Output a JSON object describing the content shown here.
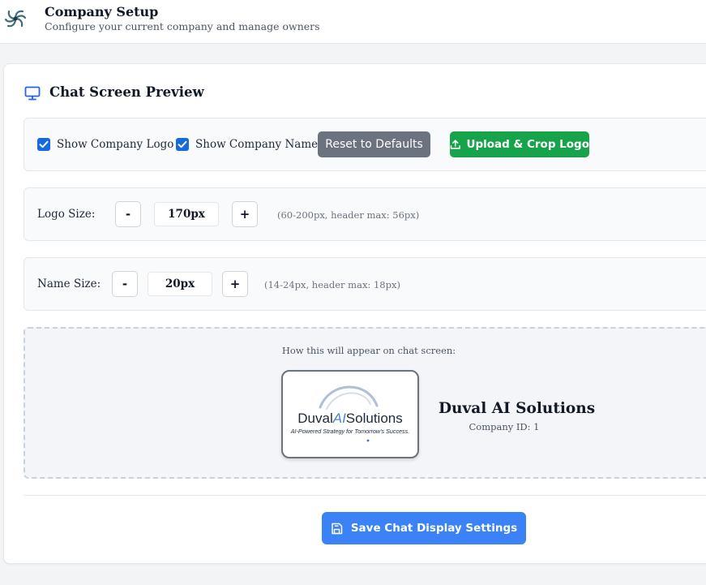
{
  "header": {
    "title": "Company Setup",
    "subtitle": "Configure your current company and manage owners",
    "logo_icon": "spiral-logo-icon"
  },
  "section": {
    "icon": "monitor-icon",
    "title": "Chat Screen Preview"
  },
  "toggles": {
    "show_logo": {
      "label": "Show Company Logo",
      "checked": true
    },
    "show_name": {
      "label": "Show Company Name",
      "checked": true
    }
  },
  "buttons": {
    "reset": "Reset to Defaults",
    "upload": "Upload & Crop Logo",
    "save": "Save Chat Display Settings"
  },
  "logo_size": {
    "label": "Logo Size:",
    "decrement": "-",
    "value": "170px",
    "increment": "+",
    "hint": "(60-200px, header max: 56px)"
  },
  "name_size": {
    "label": "Name Size:",
    "decrement": "-",
    "value": "20px",
    "increment": "+",
    "hint": "(14-24px, header max: 18px)"
  },
  "preview": {
    "caption": "How this will appear on chat screen:",
    "logo": {
      "brand_name": "Duval",
      "brand_ai": "AI",
      "brand_suffix": "Solutions",
      "tagline": "AI-Powered Strategy for Tomorrow's Success."
    },
    "company_name": "Duval AI Solutions",
    "company_id": "Company ID: 1"
  },
  "colors": {
    "primary_blue": "#3b82f6",
    "success_green": "#16a34a",
    "neutral_gray": "#6b7280",
    "checkbox_blue": "#1769e0"
  }
}
